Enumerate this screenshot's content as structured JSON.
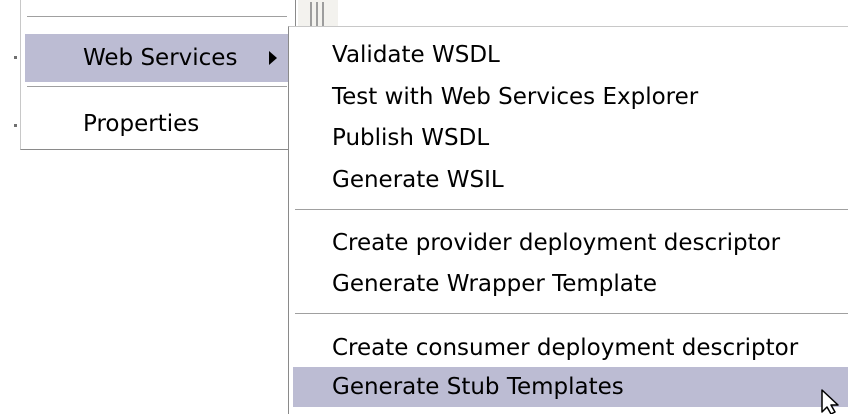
{
  "context_menu": {
    "items": [
      {
        "label": "Web Services",
        "has_submenu": true,
        "highlighted": true
      },
      {
        "label": "Properties",
        "has_submenu": false,
        "highlighted": false
      }
    ]
  },
  "web_services_submenu": {
    "groups": [
      {
        "items": [
          {
            "label": "Validate WSDL"
          },
          {
            "label": "Test with Web Services Explorer"
          },
          {
            "label": "Publish WSDL"
          },
          {
            "label": "Generate WSIL"
          }
        ]
      },
      {
        "items": [
          {
            "label": "Create provider deployment descriptor"
          },
          {
            "label": "Generate Wrapper Template"
          }
        ]
      },
      {
        "items": [
          {
            "label": "Create consumer deployment descriptor"
          },
          {
            "label": "Generate Stub Templates",
            "highlighted": true
          }
        ]
      }
    ]
  },
  "colors": {
    "highlight": "#bcbcd3",
    "menu_background": "#ffffff",
    "separator": "#a0a0a0"
  },
  "icons": [
    "submenu-arrow-icon",
    "mouse-pointer-icon"
  ]
}
